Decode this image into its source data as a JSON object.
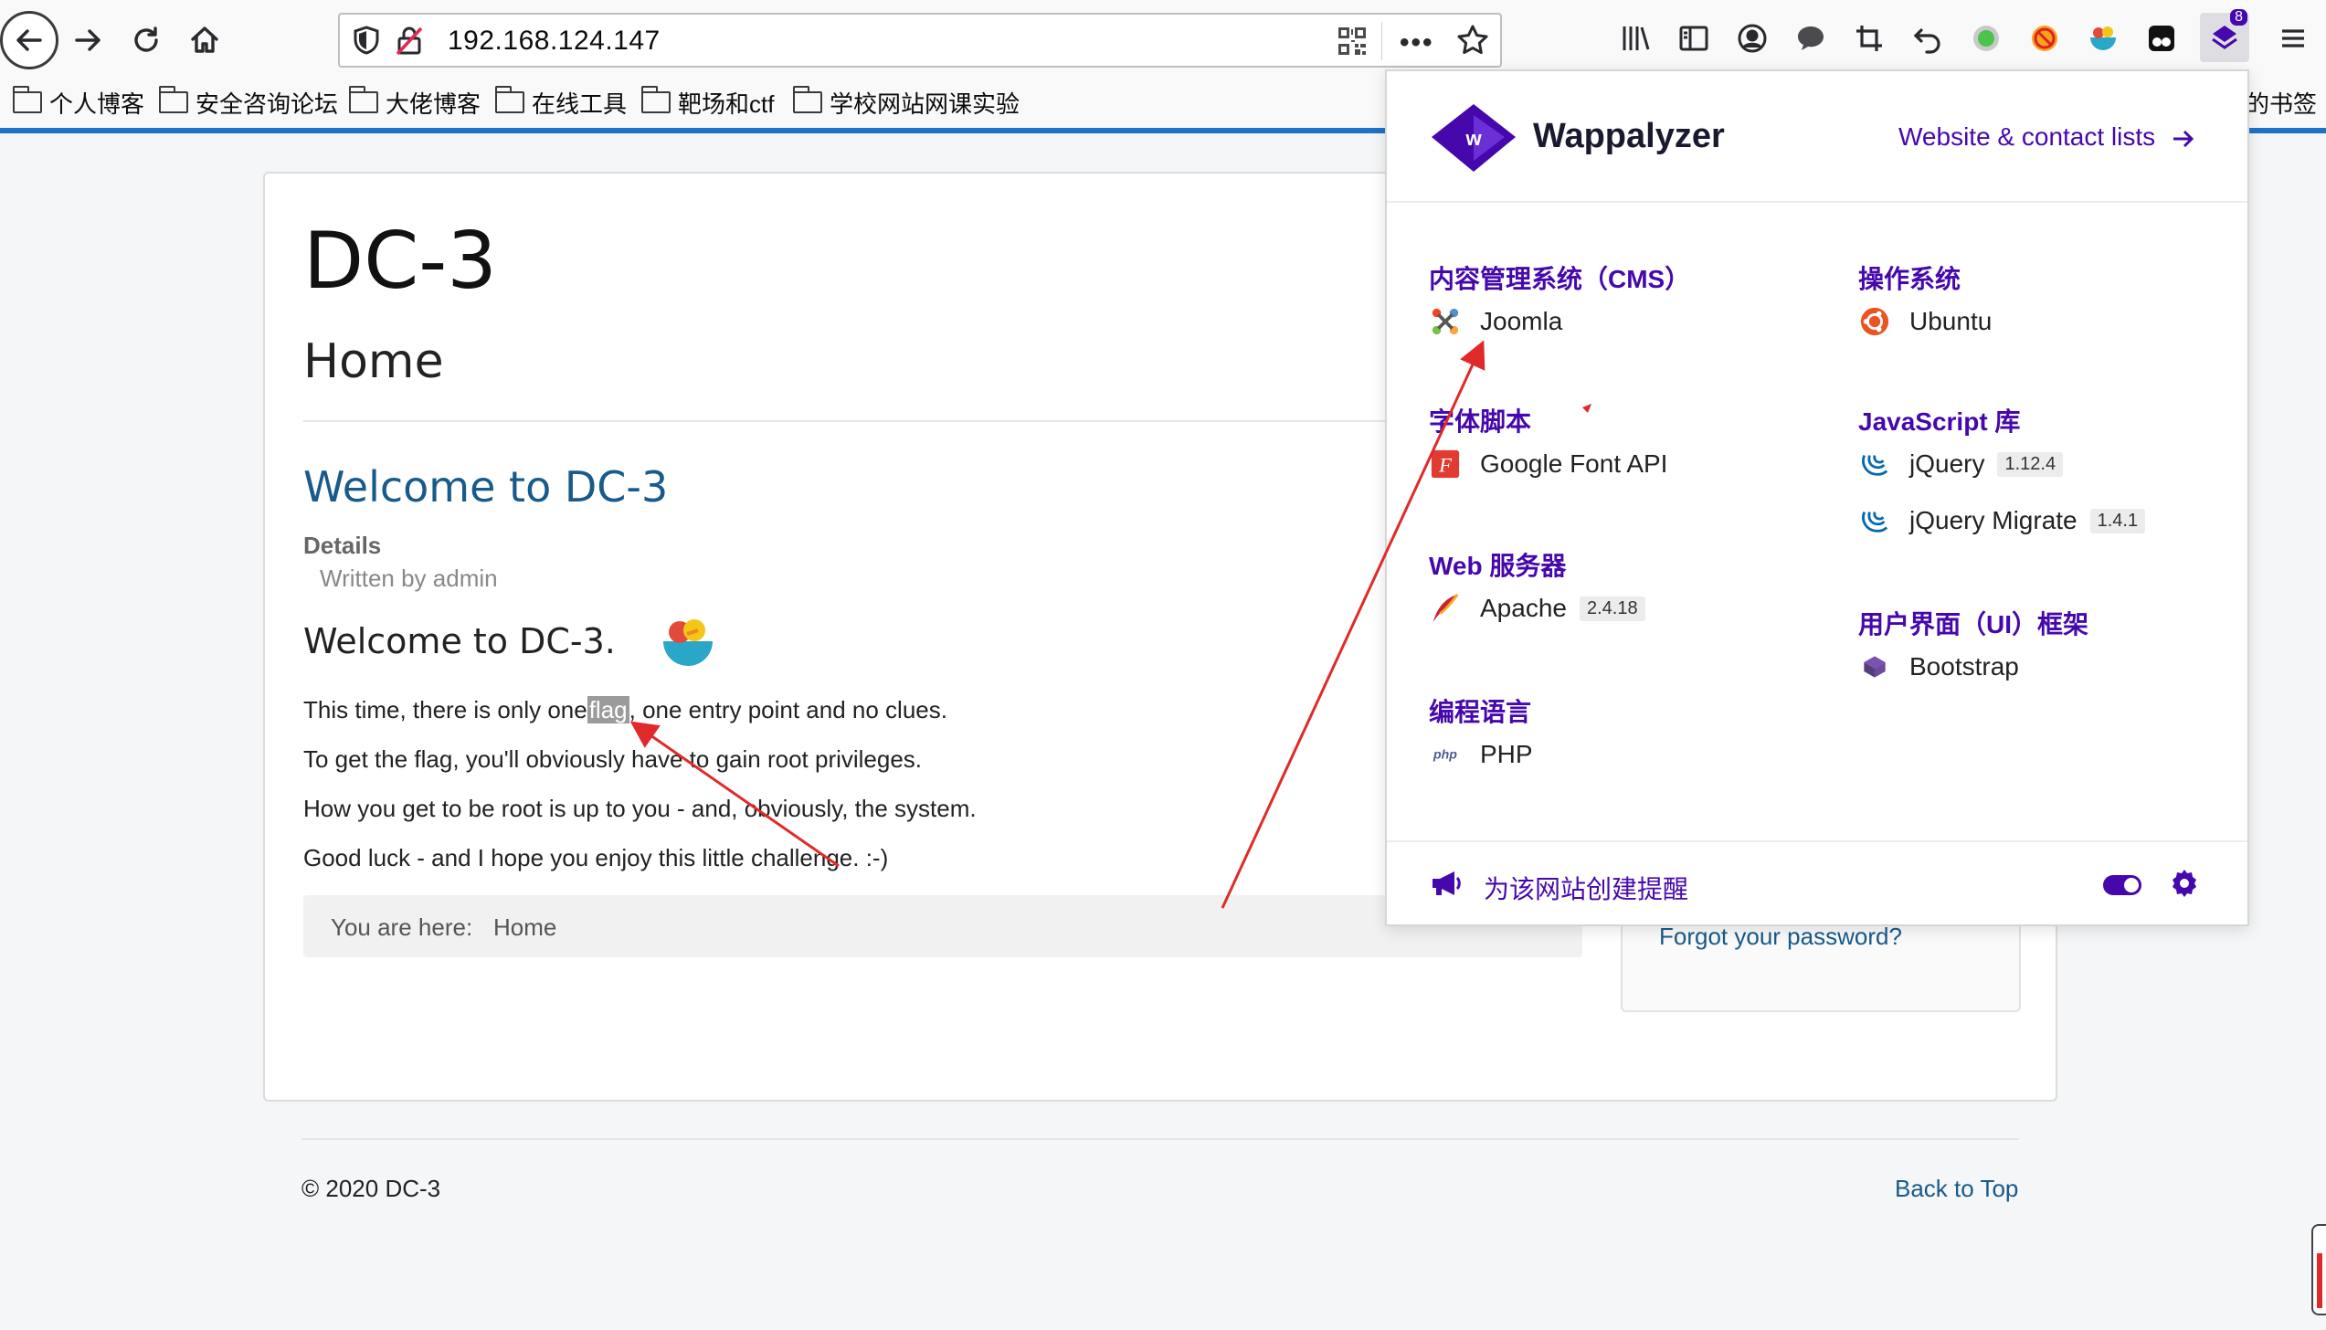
{
  "browser": {
    "url": "192.168.124.147",
    "extension_badge": "8",
    "bookmarks": [
      "个人博客",
      "安全咨询论坛",
      "大佬博客",
      "在线工具",
      "靶场和ctf",
      "学校网站网课实验"
    ],
    "bookmarks_overflow": "的书签"
  },
  "site": {
    "title": "DC-3",
    "heading": "Home",
    "article_title": "Welcome to DC-3",
    "details_label": "Details",
    "written_by": "Written by admin",
    "welcome_heading": "Welcome to DC-3.",
    "para1_before": "This time, there is only one",
    "para1_flag": "flag",
    "para1_after": ", one entry point and no clues.",
    "para2": "To get the flag, you'll obviously have to gain root privileges.",
    "para3": "How you get to be root is up to you - and, obviously, the system.",
    "para4": "Good luck - and I hope you enjoy this little challenge.  :-)",
    "breadcrumb_prefix": "You are here:",
    "breadcrumb_home": "Home",
    "forgot_password": "Forgot your password?",
    "copyright": "© 2020 DC-3",
    "back_to_top": "Back to Top"
  },
  "wappalyzer": {
    "name": "Wappalyzer",
    "header_link": "Website & contact lists",
    "categories": {
      "cms": "内容管理系统（CMS）",
      "os": "操作系统",
      "font": "字体脚本",
      "js": "JavaScript 库",
      "web": "Web 服务器",
      "ui": "用户界面（UI）框架",
      "lang": "编程语言"
    },
    "tech": {
      "joomla": "Joomla",
      "ubuntu": "Ubuntu",
      "google_font": "Google Font API",
      "jquery": "jQuery",
      "jquery_ver": "1.12.4",
      "jquery_migrate": "jQuery Migrate",
      "jquery_migrate_ver": "1.4.1",
      "apache": "Apache",
      "apache_ver": "2.4.18",
      "bootstrap": "Bootstrap",
      "php": "PHP"
    },
    "footer_alert": "为该网站创建提醒"
  },
  "colors": {
    "wappalyzer_purple": "#4608ad",
    "link_blue": "#185a8a",
    "annotation_red": "#e02a2a"
  }
}
